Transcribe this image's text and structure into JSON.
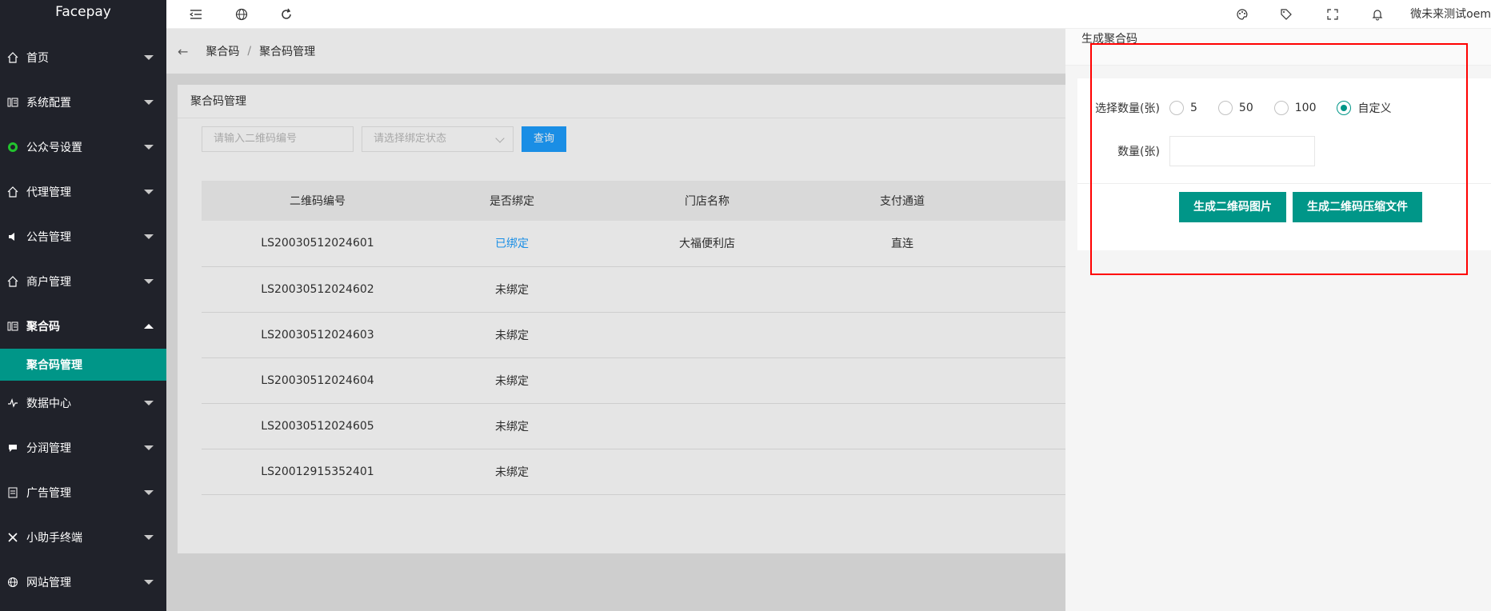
{
  "app": {
    "logo": "Facepay"
  },
  "sidebar": {
    "items": [
      {
        "label": "首页",
        "icon": "home-icon"
      },
      {
        "label": "系统配置",
        "icon": "settings-icon"
      },
      {
        "label": "公众号设置",
        "icon": "wechat-icon"
      },
      {
        "label": "代理管理",
        "icon": "home-icon"
      },
      {
        "label": "公告管理",
        "icon": "speaker-icon"
      },
      {
        "label": "商户管理",
        "icon": "home-icon"
      },
      {
        "label": "聚合码",
        "icon": "settings-icon"
      },
      {
        "label": "数据中心",
        "icon": "pulse-icon"
      },
      {
        "label": "分润管理",
        "icon": "chat-icon"
      },
      {
        "label": "广告管理",
        "icon": "doc-icon"
      },
      {
        "label": "小助手终端",
        "icon": "tools-icon"
      },
      {
        "label": "网站管理",
        "icon": "globe-icon"
      }
    ],
    "active_sub": "聚合码管理"
  },
  "header": {
    "user": "微未来测试oem"
  },
  "breadcrumb": {
    "first": "聚合码",
    "sep": "/",
    "second": "聚合码管理"
  },
  "card": {
    "title": "聚合码管理",
    "search_placeholder": "请输入二维码编号",
    "status_placeholder": "请选择绑定状态",
    "query_label": "查询"
  },
  "table": {
    "headers": [
      "二维码编号",
      "是否绑定",
      "门店名称",
      "支付通道"
    ],
    "rows": [
      {
        "code": "LS20030512024601",
        "bind": "已绑定",
        "store": "大福便利店",
        "channel": "直连"
      },
      {
        "code": "LS20030512024602",
        "bind": "未绑定",
        "store": "",
        "channel": ""
      },
      {
        "code": "LS20030512024603",
        "bind": "未绑定",
        "store": "",
        "channel": ""
      },
      {
        "code": "LS20030512024604",
        "bind": "未绑定",
        "store": "",
        "channel": ""
      },
      {
        "code": "LS20030512024605",
        "bind": "未绑定",
        "store": "",
        "channel": ""
      },
      {
        "code": "LS20012915352401",
        "bind": "未绑定",
        "store": "",
        "channel": ""
      }
    ]
  },
  "panel": {
    "title": "生成聚合码",
    "qty_label": "选择数量(张)",
    "options": [
      "5",
      "50",
      "100",
      "自定义"
    ],
    "selected": "自定义",
    "count_label": "数量(张)",
    "btn_image": "生成二维码图片",
    "btn_zip": "生成二维码压缩文件"
  },
  "colors": {
    "accent": "#009688",
    "link": "#1e9fff",
    "sidebar": "#20222a",
    "highlight": "#ff0000"
  }
}
